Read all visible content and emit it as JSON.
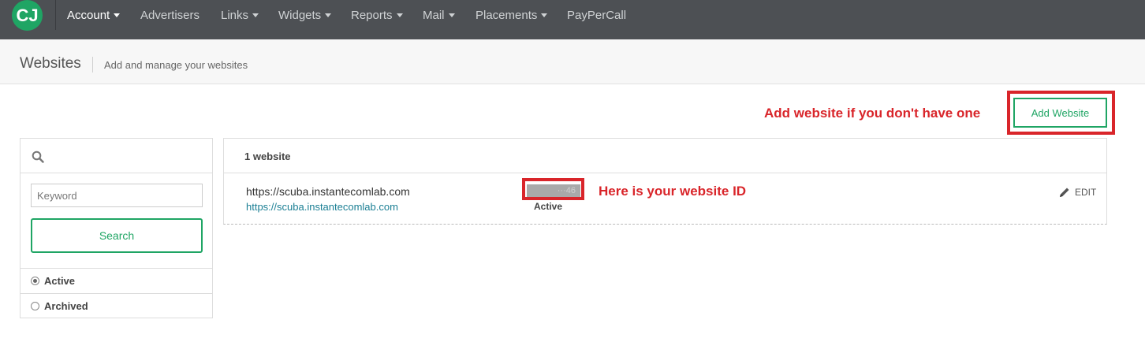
{
  "nav": {
    "logo_label": "CJ",
    "items": [
      {
        "label": "Account",
        "has_caret": true
      },
      {
        "label": "Advertisers",
        "has_caret": false
      },
      {
        "label": "Links",
        "has_caret": true
      },
      {
        "label": "Widgets",
        "has_caret": true
      },
      {
        "label": "Reports",
        "has_caret": true
      },
      {
        "label": "Mail",
        "has_caret": true
      },
      {
        "label": "Placements",
        "has_caret": true
      },
      {
        "label": "PayPerCall",
        "has_caret": false
      }
    ]
  },
  "header": {
    "title": "Websites",
    "subtitle": "Add and manage your websites"
  },
  "annotations": {
    "add_hint": "Add website if you don't have one",
    "id_hint": "Here is your website ID"
  },
  "toolbar": {
    "add_website_label": "Add Website"
  },
  "filter": {
    "search_placeholder": "Keyword",
    "search_button": "Search",
    "options": [
      {
        "label": "Active",
        "checked": true
      },
      {
        "label": "Archived",
        "checked": false
      }
    ]
  },
  "websites": {
    "count_label": "1 website",
    "rows": [
      {
        "name": "https://scuba.instantecomlab.com",
        "url": "https://scuba.instantecomlab.com",
        "id_masked": "···46",
        "status": "Active",
        "edit_label": "EDIT"
      }
    ]
  },
  "colors": {
    "nav_bg": "#4d5054",
    "brand_green": "#1fa564",
    "annotation_red": "#d9252a",
    "link_blue": "#1b7f94"
  },
  "icons": [
    "cj-logo-icon",
    "caret-down-icon",
    "search-icon",
    "pencil-icon",
    "radio-icon"
  ]
}
